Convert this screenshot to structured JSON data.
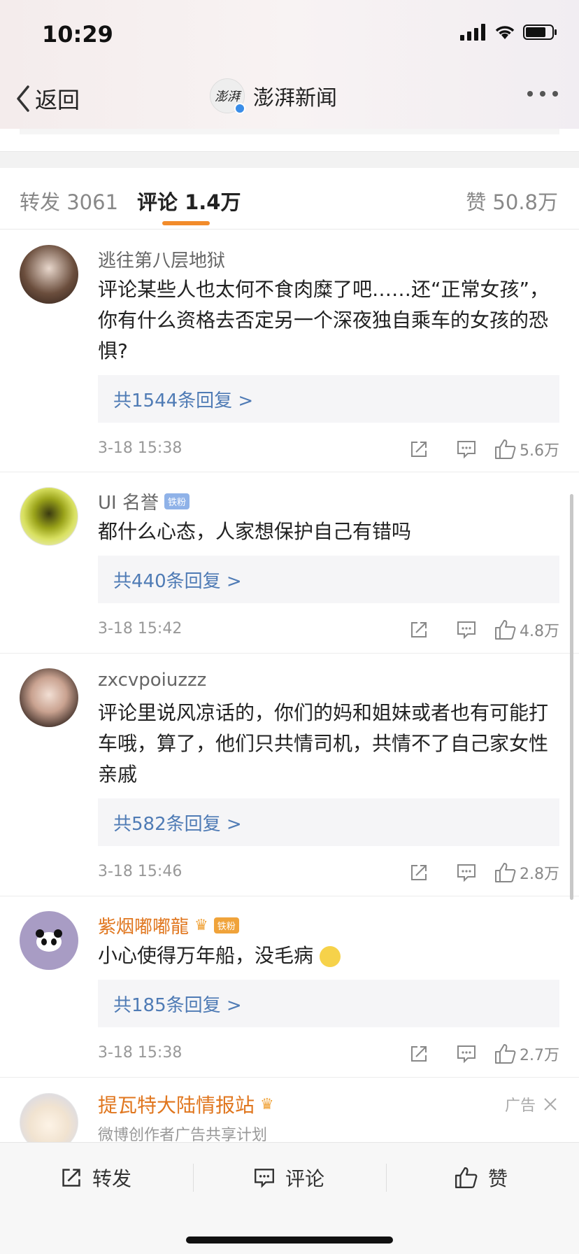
{
  "status": {
    "time": "10:29"
  },
  "nav": {
    "back_label": "返回",
    "title": "澎湃新闻",
    "logo_text": "澎湃"
  },
  "tabs": [
    {
      "label": "转发 3061"
    },
    {
      "label": "评论 1.4万"
    },
    {
      "label": "赞 50.8万"
    }
  ],
  "colors": {
    "accent": "#f28b2a",
    "link": "#4f7bb5",
    "vip_name": "#e0761e"
  },
  "comments": [
    {
      "name": "逃往第八层地狱",
      "text": "评论某些人也太何不食肉糜了吧……还“正常女孩”，你有什么资格去否定另一个深夜独自乘车的女孩的恐惧?",
      "replies": "共1544条回复 >",
      "time": "3-18 15:38",
      "likes": "5.6万"
    },
    {
      "name": "UI 名誉",
      "badge": "铁粉",
      "text": "都什么心态，人家想保护自己有错吗",
      "replies": "共440条回复 >",
      "time": "3-18 15:42",
      "likes": "4.8万"
    },
    {
      "name": "zxcvpoiuzzz",
      "text": "评论里说风凉话的，你们的妈和姐妹或者也有可能打车哦，算了，他们只共情司机，共情不了自己家女性亲戚",
      "replies": "共582条回复 >",
      "time": "3-18 15:46",
      "likes": "2.8万"
    },
    {
      "name": "紫烟嘟嘟龍",
      "badge": "铁粉",
      "text": "小心使得万年船，没毛病",
      "replies": "共185条回复 >",
      "time": "3-18 15:38",
      "likes": "2.7万"
    }
  ],
  "ad": {
    "name": "提瓦特大陆情报站",
    "subtitle": "微博创作者广告共享计划",
    "tag": "广告"
  },
  "bottom_bar": {
    "repost": "转发",
    "comment": "评论",
    "like": "赞"
  }
}
